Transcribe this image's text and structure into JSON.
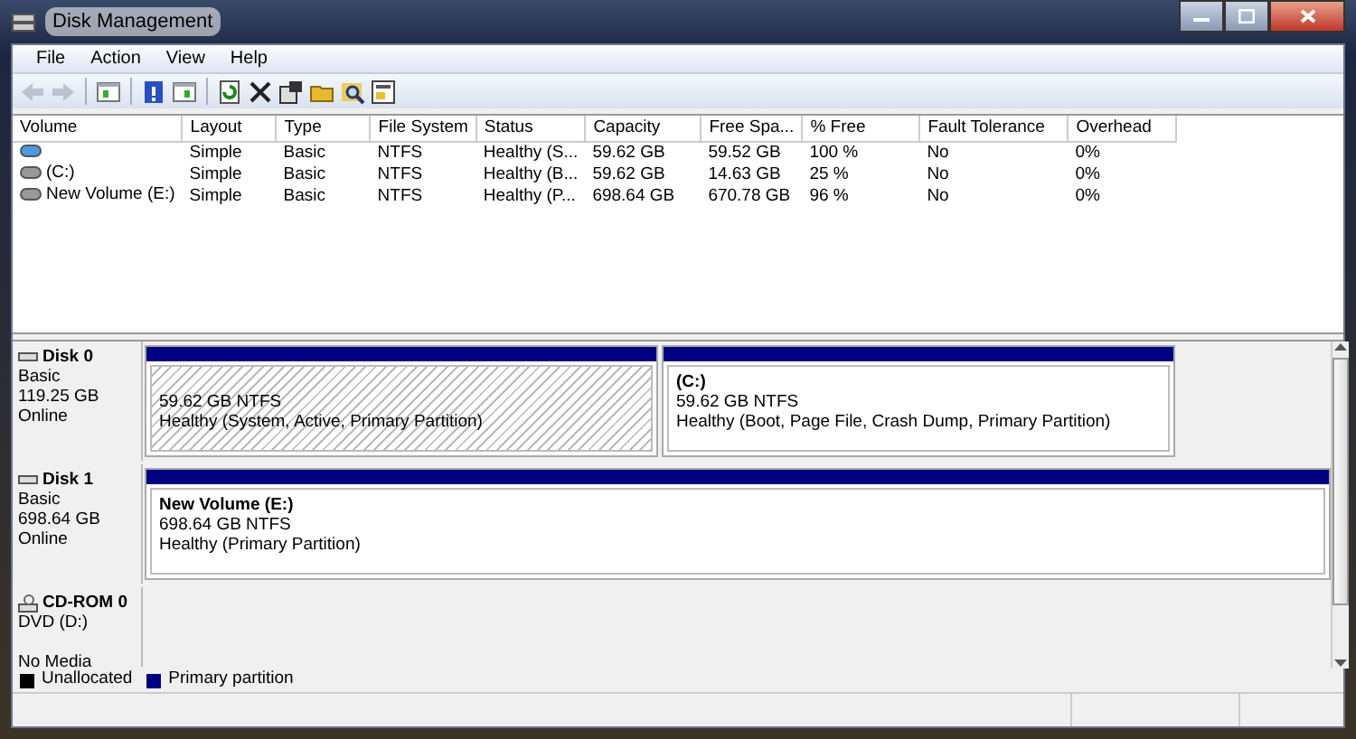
{
  "window": {
    "title": "Disk Management"
  },
  "menu": [
    "File",
    "Action",
    "View",
    "Help"
  ],
  "toolbar": [
    {
      "kind": "back",
      "disabled": true
    },
    {
      "kind": "forward",
      "disabled": true
    },
    {
      "kind": "sep"
    },
    {
      "kind": "panel",
      "disabled": false
    },
    {
      "kind": "sep"
    },
    {
      "kind": "help",
      "disabled": false
    },
    {
      "kind": "panel2",
      "disabled": false
    },
    {
      "kind": "sep"
    },
    {
      "kind": "refresh",
      "disabled": false
    },
    {
      "kind": "delete",
      "disabled": false
    },
    {
      "kind": "properties",
      "disabled": false
    },
    {
      "kind": "open",
      "disabled": false
    },
    {
      "kind": "explore",
      "disabled": false
    },
    {
      "kind": "settings",
      "disabled": false
    }
  ],
  "table": {
    "columns": [
      "Volume",
      "Layout",
      "Type",
      "File System",
      "Status",
      "Capacity",
      "Free Spa...",
      "% Free",
      "Fault Tolerance",
      "Overhead"
    ],
    "rows": [
      {
        "kind": "system",
        "cells": [
          null,
          "Simple",
          "Basic",
          "NTFS",
          "Healthy (S...",
          "59.62 GB",
          "59.52 GB",
          "100 %",
          "No",
          "0%"
        ]
      },
      {
        "kind": "drive",
        "cells": [
          "(C:)",
          "Simple",
          "Basic",
          "NTFS",
          "Healthy (B...",
          "59.62 GB",
          "14.63 GB",
          "25 %",
          "No",
          "0%"
        ]
      },
      {
        "kind": "drive",
        "cells": [
          "New Volume (E:)",
          "Simple",
          "Basic",
          "NTFS",
          "Healthy (P...",
          "698.64 GB",
          "670.78 GB",
          "96 %",
          "No",
          "0%"
        ]
      }
    ]
  },
  "disks": [
    {
      "kind": "disk",
      "name": "Disk 0",
      "lines": [
        "Basic",
        "119.25 GB",
        "Online"
      ],
      "partitions": [
        {
          "kind": "hatched",
          "size": "59.62 GB NTFS",
          "status": "Healthy (System, Active, Primary Partition)"
        },
        {
          "kind": "plain",
          "name": "(C:)",
          "size": "59.62 GB NTFS",
          "status": "Healthy (Boot, Page File, Crash Dump, Primary Partition)"
        }
      ]
    },
    {
      "kind": "disk",
      "name": "Disk 1",
      "lines": [
        "Basic",
        "698.64 GB",
        "Online"
      ],
      "partitions": [
        {
          "kind": "plain",
          "name": "New Volume  (E:)",
          "size": "698.64 GB NTFS",
          "status": "Healthy (Primary Partition)"
        }
      ]
    },
    {
      "kind": "cdrom",
      "name": "CD-ROM 0",
      "lines": [
        "DVD (D:)",
        "No Media"
      ]
    }
  ],
  "legend": [
    {
      "label": "Unallocated",
      "color": "#000000"
    },
    {
      "label": "Primary partition",
      "color": "#000080"
    }
  ]
}
